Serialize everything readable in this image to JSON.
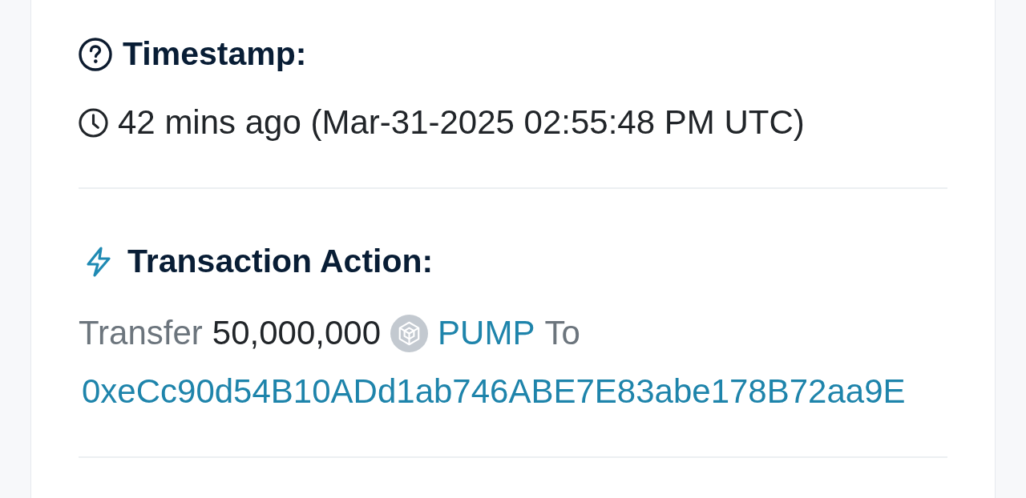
{
  "sections": [
    {
      "kind": "timestamp",
      "heading": "Timestamp:",
      "value": "42 mins ago (Mar-31-2025 02:55:48 PM UTC)"
    },
    {
      "kind": "action",
      "heading": "Transaction Action:",
      "action": {
        "verb": "Transfer",
        "amount": "50,000,000",
        "token": "PUMP",
        "preposition": "To",
        "address": "0xeCc90d54B10ADd1ab746ABE7E83abe178B72aa9E"
      }
    }
  ]
}
